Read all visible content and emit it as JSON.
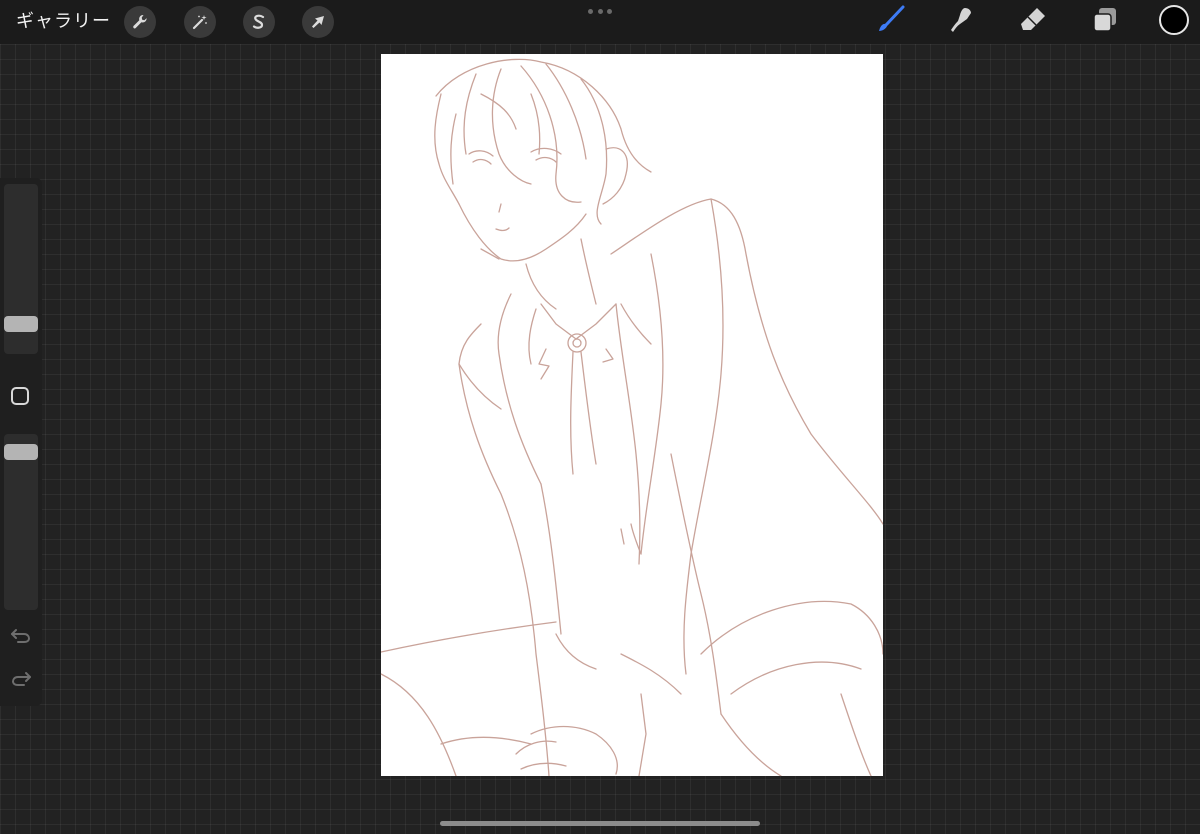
{
  "toolbar": {
    "gallery_label": "ギャラリー",
    "actions_icon": "wrench-icon",
    "adjustments_icon": "magic-wand-icon",
    "selection_icon": "selection-s-icon",
    "transform_icon": "arrow-cursor-icon",
    "brush_icon": "brush-icon",
    "smudge_icon": "smudge-finger-icon",
    "eraser_icon": "eraser-icon",
    "layers_icon": "layers-icon",
    "current_color": "#000000",
    "active_tool_color": "#3d7bf5"
  },
  "sidebar": {
    "brush_size_level": 0.14,
    "opacity_level": 0.94,
    "modify_icon": "square-modify-icon",
    "undo_icon": "undo-arrow-icon",
    "redo_icon": "redo-arrow-icon"
  },
  "canvas": {
    "background": "#ffffff",
    "sketch_color": "#c9a39a",
    "content": "line-art-sketch"
  }
}
